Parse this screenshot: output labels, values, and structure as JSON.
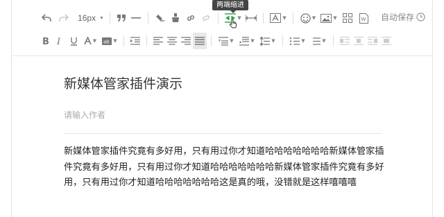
{
  "toolbar": {
    "font_size": "16px",
    "autosave_label": "自动保存",
    "tooltip": "两端缩进",
    "icons_row1": [
      "undo-icon",
      "redo-icon",
      "quote-icon",
      "horizontal-rule-icon",
      "clear-format-icon",
      "format-painter-icon",
      "link-icon",
      "unlink-icon",
      "indent-both-icon",
      "line-height-icon",
      "font-family-icon",
      "emoji-icon",
      "image-icon",
      "template-icon",
      "word-import-icon"
    ],
    "icons_row2": [
      "bold-icon",
      "italic-icon",
      "underline-icon",
      "font-color-icon",
      "background-color-icon",
      "indent-icon",
      "align-left-icon",
      "align-center-icon",
      "align-right-icon",
      "align-justify-icon",
      "spacing-before-icon",
      "spacing-after-icon",
      "line-spacing-icon",
      "ordered-list-icon",
      "unordered-list-icon",
      "float-left-icon",
      "float-none-icon",
      "float-right-icon",
      "float-center-icon"
    ]
  },
  "document": {
    "title": "新媒体管家插件演示",
    "author_placeholder": "请输入作者",
    "body": "新媒体管家插件究竟有多好用，只有用过你才知道哈哈哈哈哈哈哈新媒体管家插件究竟有多好用，只有用过你才知道哈哈哈哈哈哈哈新媒体管家插件究竟有多好用，只有用过你才知道哈哈哈哈哈哈哈这是真的哦，没错就是这样嘻嘻嘻"
  },
  "colors": {
    "accent_green": "#3aa64a",
    "tooltip_bg": "#444444",
    "text_dark": "#222222",
    "placeholder": "#aaaaaa"
  }
}
